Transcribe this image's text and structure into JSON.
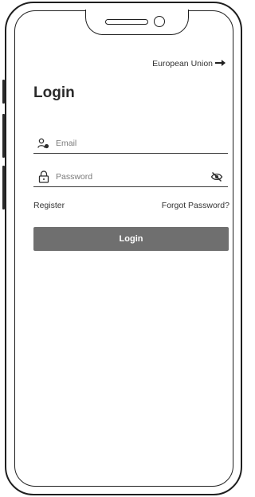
{
  "region": {
    "label": "European Union",
    "arrow_icon": "arrow-right-icon"
  },
  "login": {
    "title": "Login",
    "email": {
      "placeholder": "Email",
      "value": "",
      "icon": "user-key-icon"
    },
    "password": {
      "placeholder": "Password",
      "value": "",
      "icon": "lock-icon",
      "toggle_icon": "eye-slash-icon"
    },
    "register_label": "Register",
    "forgot_label": "Forgot Password?",
    "button_label": "Login"
  },
  "colors": {
    "button_bg": "#6f6f6f",
    "button_text": "#ffffff",
    "text": "#2f2f2f",
    "frame": "#1f1f1f"
  }
}
